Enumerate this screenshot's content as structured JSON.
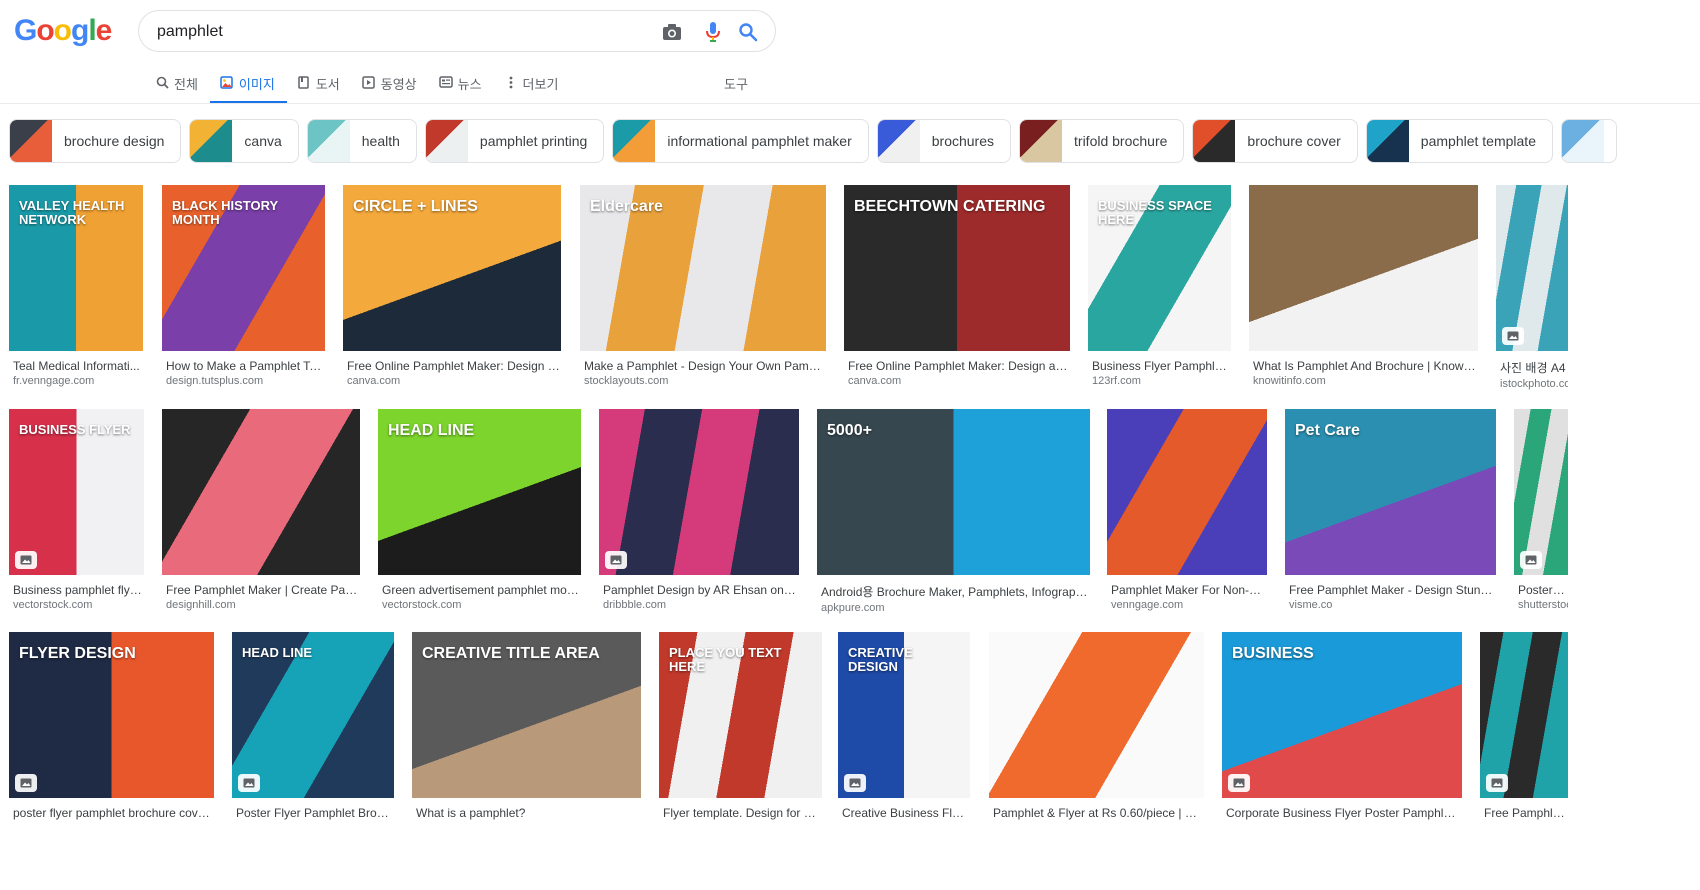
{
  "logo": {
    "letters": [
      "G",
      "o",
      "o",
      "g",
      "l",
      "e"
    ]
  },
  "search": {
    "value": "pamphlet"
  },
  "tabs": [
    {
      "label": "전체",
      "icon": "search-icon"
    },
    {
      "label": "이미지",
      "icon": "image-icon",
      "active": true
    },
    {
      "label": "도서",
      "icon": "book-icon"
    },
    {
      "label": "동영상",
      "icon": "video-icon"
    },
    {
      "label": "뉴스",
      "icon": "news-icon"
    },
    {
      "label": "더보기",
      "icon": "more-vert-icon"
    }
  ],
  "tools_label": "도구",
  "chips": [
    {
      "label": "brochure design",
      "colors": [
        "#3a3f4a",
        "#e85d3a"
      ]
    },
    {
      "label": "canva",
      "colors": [
        "#f2b233",
        "#1d8c8c"
      ]
    },
    {
      "label": "health",
      "colors": [
        "#6cc4c4",
        "#e9f5f5"
      ]
    },
    {
      "label": "pamphlet printing",
      "colors": [
        "#c0392b",
        "#ecf0f1"
      ]
    },
    {
      "label": "informational pamphlet maker",
      "colors": [
        "#1b9aa8",
        "#f29d38"
      ]
    },
    {
      "label": "brochures",
      "colors": [
        "#3a5bd9",
        "#f0f0f0"
      ]
    },
    {
      "label": "trifold brochure",
      "colors": [
        "#7a1f1f",
        "#d9c7a1"
      ]
    },
    {
      "label": "brochure cover",
      "colors": [
        "#e04f2a",
        "#2a2a2a"
      ]
    },
    {
      "label": "pamphlet template",
      "colors": [
        "#1fa3c9",
        "#16324f"
      ]
    },
    {
      "label": "",
      "colors": [
        "#6bb0e0",
        "#eaf4fb"
      ]
    }
  ],
  "results": [
    {
      "title": "Teal Medical Informati...",
      "source": "fr.venngage.com",
      "colors": [
        "#1a9aa8",
        "#f0a133"
      ],
      "overlay": "VALLEY HEALTH NETWORK"
    },
    {
      "title": "How to Make a Pamphlet Te...",
      "source": "design.tutsplus.com",
      "colors": [
        "#7a3fa8",
        "#e8612c"
      ],
      "overlay": "BLACK HISTORY MONTH"
    },
    {
      "title": "Free Online Pamphlet Maker: Design a ...",
      "source": "canva.com",
      "colors": [
        "#f4a93c",
        "#1d2a3a"
      ],
      "overlay": "CIRCLE + LINES"
    },
    {
      "title": "Make a Pamphlet - Design Your Own Pamphl...",
      "source": "stocklayouts.com",
      "colors": [
        "#e9a23b",
        "#e8e8ea"
      ],
      "overlay": "Eldercare"
    },
    {
      "title": "Free Online Pamphlet Maker: Design a Cu...",
      "source": "canva.com",
      "colors": [
        "#2a2a2a",
        "#9e2b2b"
      ],
      "overlay": "BEECHTOWN CATERING"
    },
    {
      "title": "Business Flyer Pamphlet ...",
      "source": "123rf.com",
      "colors": [
        "#2aa6a0",
        "#f5f5f5"
      ],
      "overlay": "BUSINESS SPACE HERE"
    },
    {
      "title": "What Is Pamphlet And Brochure | Know It ...",
      "source": "knowitinfo.com",
      "colors": [
        "#8a6b4a",
        "#f2f2f2"
      ],
      "overlay": ""
    },
    {
      "title": "사진 배경 A4",
      "source": "istockphoto.co",
      "colors": [
        "#3aa3b8",
        "#dfe8ea"
      ],
      "overlay": ""
    },
    {
      "title": "Business pamphlet flye...",
      "source": "vectorstock.com",
      "colors": [
        "#d6304a",
        "#f1f1f3"
      ],
      "overlay": "BUSINESS FLYER"
    },
    {
      "title": "Free Pamphlet Maker | Create Pam...",
      "source": "designhill.com",
      "colors": [
        "#e96a7a",
        "#262626"
      ],
      "overlay": ""
    },
    {
      "title": "Green advertisement pamphlet mod...",
      "source": "vectorstock.com",
      "colors": [
        "#7cd42c",
        "#1c1c1c"
      ],
      "overlay": "HEAD LINE"
    },
    {
      "title": "Pamphlet Design by AR Ehsan on Dr...",
      "source": "dribbble.com",
      "colors": [
        "#2b2d4f",
        "#d53a7a"
      ],
      "overlay": ""
    },
    {
      "title": "Android용 Brochure Maker, Pamphlets, Infographic...",
      "source": "apkpure.com",
      "colors": [
        "#37474f",
        "#1ea0d8"
      ],
      "overlay": "5000+"
    },
    {
      "title": "Pamphlet Maker For Non-De...",
      "source": "venngage.com",
      "colors": [
        "#e55a2b",
        "#4a3fb8"
      ],
      "overlay": ""
    },
    {
      "title": "Free Pamphlet Maker - Design Stunnin...",
      "source": "visme.co",
      "colors": [
        "#2a8fb0",
        "#7a4ab8"
      ],
      "overlay": "Pet Care"
    },
    {
      "title": "Poster Fly",
      "source": "shutterstoc",
      "colors": [
        "#2aa67a",
        "#e0e0e0"
      ],
      "overlay": ""
    },
    {
      "title": "poster flyer pamphlet brochure cover...",
      "source": "",
      "colors": [
        "#1f2a44",
        "#e8562b"
      ],
      "overlay": "FLYER DESIGN"
    },
    {
      "title": "Poster Flyer Pamphlet Broch...",
      "source": "",
      "colors": [
        "#16a3b8",
        "#1f3a5a"
      ],
      "overlay": "HEAD LINE"
    },
    {
      "title": "What is a pamphlet?",
      "source": "",
      "colors": [
        "#5a5a5a",
        "#b89a7a"
      ],
      "overlay": "CREATIVE TITLE AREA"
    },
    {
      "title": "Flyer template. Design for a ...",
      "source": "",
      "colors": [
        "#f0f0f0",
        "#c0392b"
      ],
      "overlay": "PLACE YOU TEXT HERE"
    },
    {
      "title": "Creative Business Flyer...",
      "source": "",
      "colors": [
        "#1e4aa8",
        "#f5f5f5"
      ],
      "overlay": "CREATIVE DESIGN"
    },
    {
      "title": "Pamphlet & Flyer at Rs 0.60/piece | C.T...",
      "source": "",
      "colors": [
        "#ef6a2c",
        "#fafafa"
      ],
      "overlay": ""
    },
    {
      "title": "Corporate Business Flyer Poster Pamphlet B...",
      "source": "",
      "colors": [
        "#1a9ad8",
        "#e04a4a"
      ],
      "overlay": "BUSINESS"
    },
    {
      "title": "Free Pamphlet T",
      "source": "",
      "colors": [
        "#1fa3a8",
        "#2a2a2a"
      ],
      "overlay": ""
    }
  ],
  "colors": {
    "accent": "#1a73e8",
    "logo": [
      "#4285F4",
      "#EA4335",
      "#FBBC05",
      "#4285F4",
      "#34A853",
      "#EA4335"
    ]
  }
}
